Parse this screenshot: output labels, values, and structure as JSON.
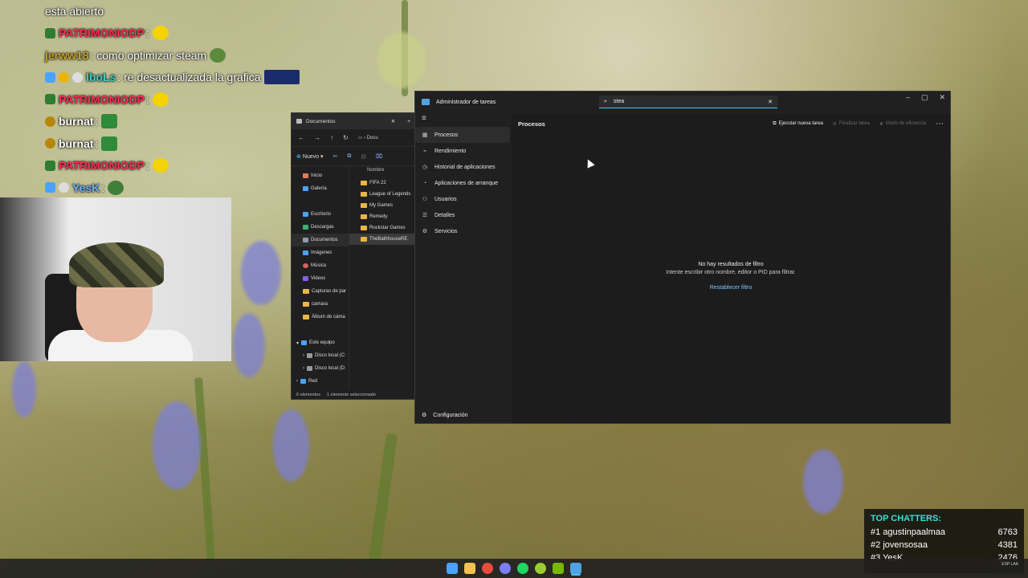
{
  "chat": {
    "lines": [
      {
        "user": "",
        "message": "esta abierto"
      },
      {
        "user": "PATRIMONIODP",
        "message": ":"
      },
      {
        "user": "jerww18",
        "message": ": como optimizar steam"
      },
      {
        "user": "lboLs",
        "message": ": re desactualizada la grafica"
      },
      {
        "user": "PATRIMONIODP",
        "message": ":"
      },
      {
        "user": "burnat",
        "message": ":"
      },
      {
        "user": "burnat",
        "message": ":"
      },
      {
        "user": "PATRIMONIODP",
        "message": ":"
      },
      {
        "user": "YesK",
        "message": ":"
      }
    ],
    "colors": {
      "patrimonio": "#ff2d55",
      "jerww": "#c9a227",
      "lbols": "#3bd1c6",
      "burnat": "#ffffff",
      "yesk": "#6bb3ff"
    }
  },
  "explorer": {
    "tab_title": "Documentos",
    "path_crumb": "Docu",
    "new_label": "Nuevo",
    "column_name": "Nombre",
    "sidebar": [
      {
        "label": "Inicio",
        "icon": "home-icon"
      },
      {
        "label": "Galería",
        "icon": "gallery-icon"
      },
      {
        "label": "Escritorio",
        "icon": "desktop-icon"
      },
      {
        "label": "Descargas",
        "icon": "download-icon"
      },
      {
        "label": "Documentos",
        "icon": "documents-icon"
      },
      {
        "label": "Imágenes",
        "icon": "pictures-icon"
      },
      {
        "label": "Música",
        "icon": "music-icon"
      },
      {
        "label": "Videos",
        "icon": "videos-icon"
      },
      {
        "label": "Capturas de par",
        "icon": "folder-icon"
      },
      {
        "label": "camara",
        "icon": "folder-icon"
      },
      {
        "label": "Álbum de cáma",
        "icon": "folder-icon"
      },
      {
        "label": "Este equipo",
        "icon": "pc-icon"
      },
      {
        "label": "Disco local (C:",
        "icon": "drive-icon"
      },
      {
        "label": "Disco local (D:",
        "icon": "drive-icon"
      },
      {
        "label": "Red",
        "icon": "network-icon"
      }
    ],
    "files": [
      "FIFA 22",
      "League of Legends",
      "My Games",
      "Remedy",
      "Rockstar Games",
      "TheBathhouseRE"
    ],
    "status_count": "6 elementos",
    "status_selected": "1 elemento seleccionado"
  },
  "taskmgr": {
    "title": "Administrador de tareas",
    "search_value": "stea",
    "nav": [
      {
        "label": "Procesos",
        "icon": "▦"
      },
      {
        "label": "Rendimiento",
        "icon": "⌁"
      },
      {
        "label": "Historial de aplicaciones",
        "icon": "◷"
      },
      {
        "label": "Aplicaciones de arranque",
        "icon": "◔"
      },
      {
        "label": "Usuarios",
        "icon": "⚇"
      },
      {
        "label": "Detalles",
        "icon": "☰"
      },
      {
        "label": "Servicios",
        "icon": "⚙"
      }
    ],
    "settings_label": "Configuración",
    "page_title": "Procesos",
    "run_task": "Ejecutar nueva tarea",
    "end_task": "Finalizar tarea",
    "efficiency": "Modo de eficiencia",
    "empty_title": "No hay resultados de filtro",
    "empty_hint": "Intente escribir otro nombre, editor o PID para filtrar.",
    "reset_filter": "Restablecer filtro"
  },
  "top_chatters": {
    "title": "TOP CHATTERS:",
    "rows": [
      {
        "rank": "#1",
        "name": "agustinpaalmaa",
        "count": "6763"
      },
      {
        "rank": "#2",
        "name": "jovensosaa",
        "count": "4381"
      },
      {
        "rank": "#3",
        "name": "YesK",
        "count": "2476"
      }
    ]
  },
  "taskbar": {
    "icons": [
      "start-icon",
      "file-explorer-icon",
      "chrome-icon",
      "discord-icon",
      "spotify-icon",
      "xbox-icon",
      "nvidia-icon",
      "task-manager-icon"
    ],
    "colors": [
      "#4aa3ff",
      "#f2c14e",
      "#e94b3c",
      "#7b7ff2",
      "#1ed760",
      "#9acd32",
      "#76b900",
      "#4fa3e3"
    ],
    "lang": "ESP LAA"
  }
}
